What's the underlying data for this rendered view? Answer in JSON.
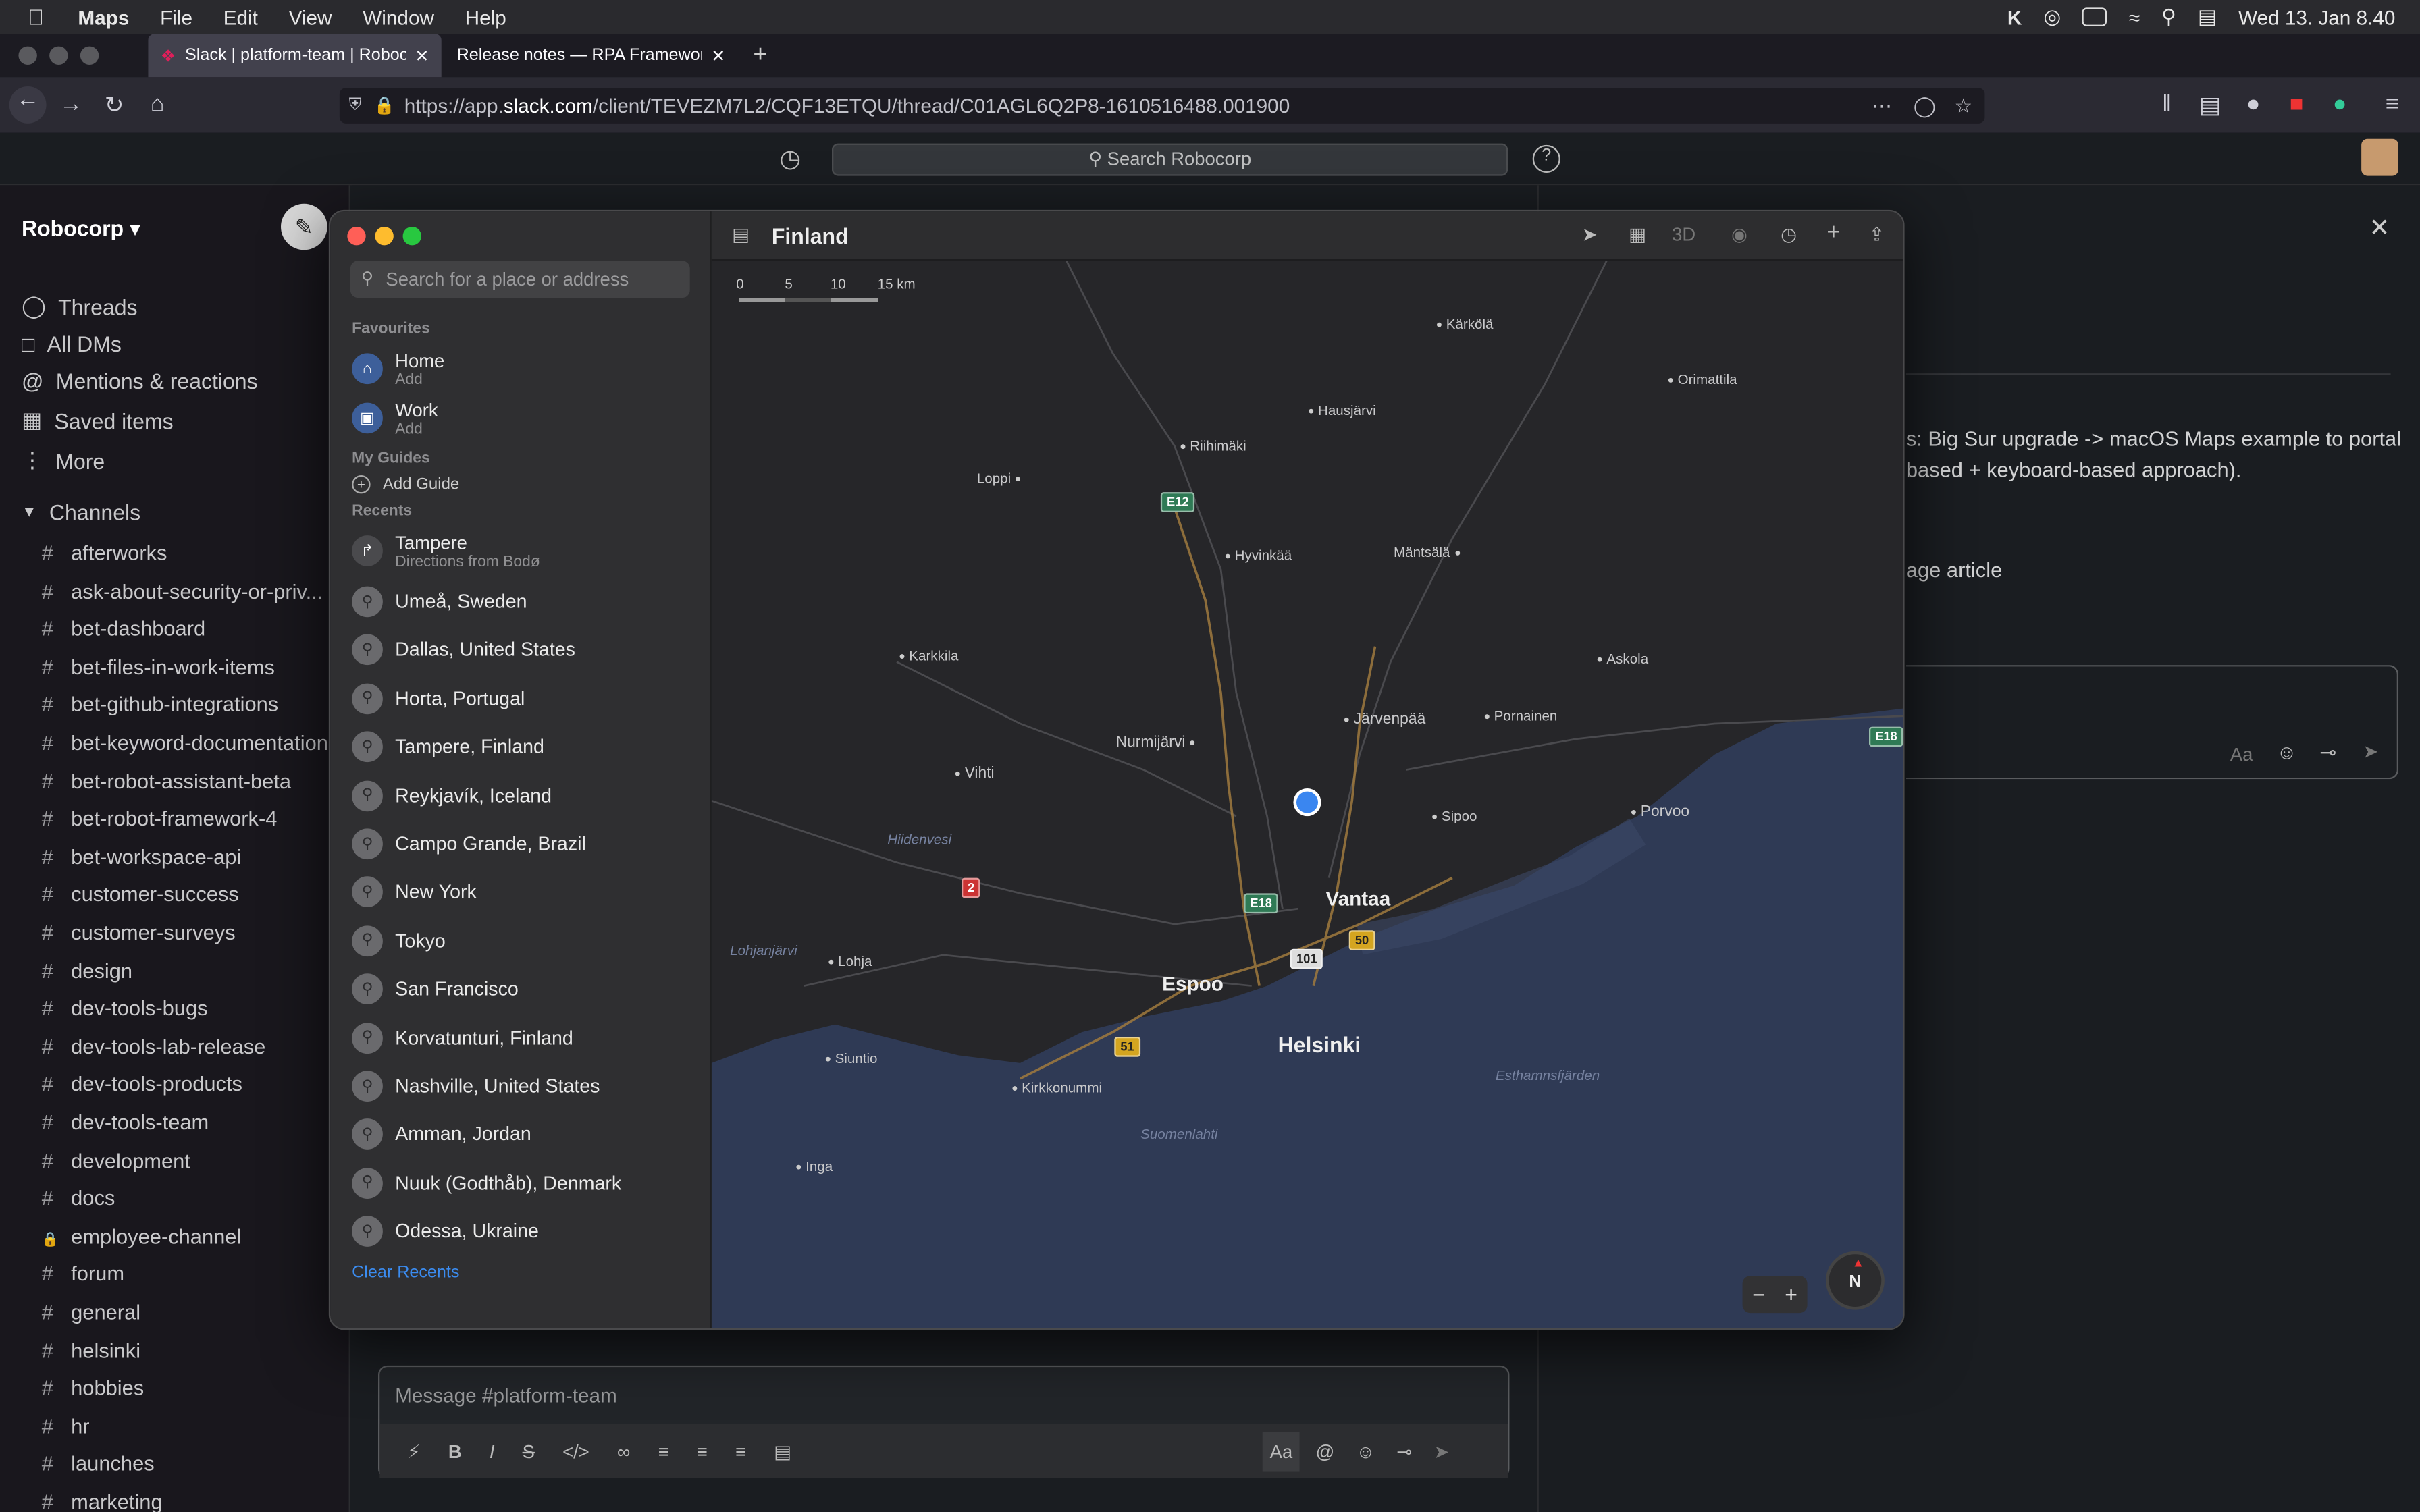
{
  "menubar": {
    "app": "Maps",
    "items": [
      "File",
      "Edit",
      "View",
      "Window",
      "Help"
    ],
    "clock": "Wed 13. Jan  8.40"
  },
  "browser": {
    "tabs": [
      {
        "label": "Slack | platform-team | Robocor"
      },
      {
        "label": "Release notes — RPA Framework do"
      }
    ],
    "url_prefix": "https://app.",
    "url_domain": "slack.com",
    "url_path": "/client/TEVEZM7L2/CQF13ETQU/thread/C01AGL6Q2P8-1610516488.001900"
  },
  "slack": {
    "search_placeholder": "Search Robocorp",
    "workspace": "Robocorp ▾",
    "nav": [
      "Threads",
      "All DMs",
      "Mentions & reactions",
      "Saved items",
      "More"
    ],
    "channels_header": "Channels",
    "channels": [
      "afterworks",
      "ask-about-security-or-priv...",
      "bet-dashboard",
      "bet-files-in-work-items",
      "bet-github-integrations",
      "bet-keyword-documentation",
      "bet-robot-assistant-beta",
      "bet-robot-framework-4",
      "bet-workspace-api",
      "customer-success",
      "customer-surveys",
      "design",
      "dev-tools-bugs",
      "dev-tools-lab-release",
      "dev-tools-products",
      "dev-tools-team",
      "development",
      "docs",
      "employee-channel",
      "forum",
      "general",
      "helsinki",
      "hobbies",
      "hr",
      "launches",
      "marketing"
    ],
    "message_placeholder": "Message #platform-team",
    "thread_line1": "s: Big Sur upgrade -> macOS Maps example to portal",
    "thread_line2": "based + keyboard-based approach).",
    "thread_line3": "age article"
  },
  "maps": {
    "title": "Finland",
    "search_placeholder": "Search for a place or address",
    "favourites_header": "Favourites",
    "favourites": [
      {
        "name": "Home",
        "sub": "Add"
      },
      {
        "name": "Work",
        "sub": "Add"
      }
    ],
    "guides_header": "My Guides",
    "add_guide": "Add Guide",
    "recents_header": "Recents",
    "recent_directions": {
      "name": "Tampere",
      "sub": "Directions from Bodø"
    },
    "recents": [
      "Umeå, Sweden",
      "Dallas, United States",
      "Horta, Portugal",
      "Tampere, Finland",
      "Reykjavík, Iceland",
      "Campo Grande, Brazil",
      "New York",
      "Tokyo",
      "San Francisco",
      "Korvatunturi, Finland",
      "Nashville, United States",
      "Amman, Jordan",
      "Nuuk (Godthåb), Denmark",
      "Odessa, Ukraine"
    ],
    "clear_recents": "Clear Recents",
    "scale": [
      "0",
      "5",
      "10",
      "15 km"
    ],
    "toolbar_3d": "3D",
    "map": {
      "cities": [
        "Espoo",
        "Vantaa",
        "Helsinki"
      ],
      "places": [
        "Kärkölä",
        "Orimattila",
        "Hausjärvi",
        "Riihimäki",
        "Loppi",
        "Hyvinkää",
        "Mäntsälä",
        "Karkkila",
        "Askola",
        "Järvenpää",
        "Pornainen",
        "Nurmijärvi",
        "Vihti",
        "Sipoo",
        "Porvoo",
        "Lohja",
        "Siuntio",
        "Kirkkonummi",
        "Inga"
      ],
      "waters": [
        "Hiidenvesi",
        "Lohjanjärvi",
        "Suomenlahti",
        "Esthamnsfjärden"
      ],
      "roads": [
        "E12",
        "E18",
        "2",
        "E18",
        "50",
        "101",
        "51",
        "E18"
      ],
      "compass": "N"
    }
  },
  "colors": {
    "accent": "#3b8cf0",
    "map_water": "#2f3a55",
    "map_land": "#262629"
  }
}
